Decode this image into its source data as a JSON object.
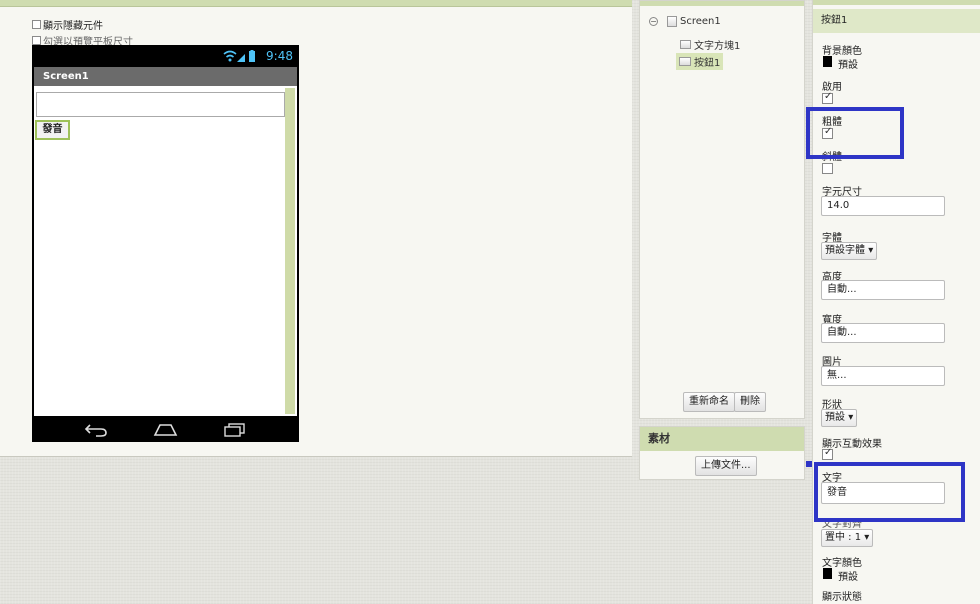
{
  "viewer": {
    "show_hidden_label": "顯示隱藏元件",
    "tablet_preview_label": "勾選以預覽平板尺寸",
    "phone": {
      "time": "9:48",
      "screen_title": "Screen1",
      "button_text": "發音"
    }
  },
  "components": {
    "tree": [
      {
        "label": "Screen1"
      },
      {
        "label": "文字方塊1"
      },
      {
        "label": "按鈕1"
      }
    ],
    "rename_button": "重新命名",
    "delete_button": "刪除"
  },
  "media": {
    "title": "素材",
    "upload_button": "上傳文件..."
  },
  "properties": {
    "component_name": "按鈕1",
    "bgcolor_label": "背景顏色",
    "bgcolor_value": "預設",
    "enabled_label": "啟用",
    "enabled_checked": true,
    "bold_label": "粗體",
    "bold_checked": true,
    "italic_label": "斜體",
    "italic_checked": false,
    "fontsize_label": "字元尺寸",
    "fontsize_value": "14.0",
    "font_label": "字體",
    "font_value": "預設字體",
    "height_label": "高度",
    "height_value": "自動...",
    "width_label": "寬度",
    "width_value": "自動...",
    "image_label": "圖片",
    "image_value": "無...",
    "shape_label": "形狀",
    "shape_value": "預設",
    "feedback_label": "顯示互動效果",
    "feedback_checked": true,
    "text_label": "文字",
    "text_value": "發音",
    "align_label": "文字對齊",
    "align_value": "置中 : 1",
    "textcolor_label": "文字顏色",
    "textcolor_value": "預設",
    "visible_label": "顯示狀態"
  },
  "colors": {
    "accent": "#cfdcb0",
    "highlight": "#2e35c6",
    "selected_border": "#9ec15a"
  }
}
